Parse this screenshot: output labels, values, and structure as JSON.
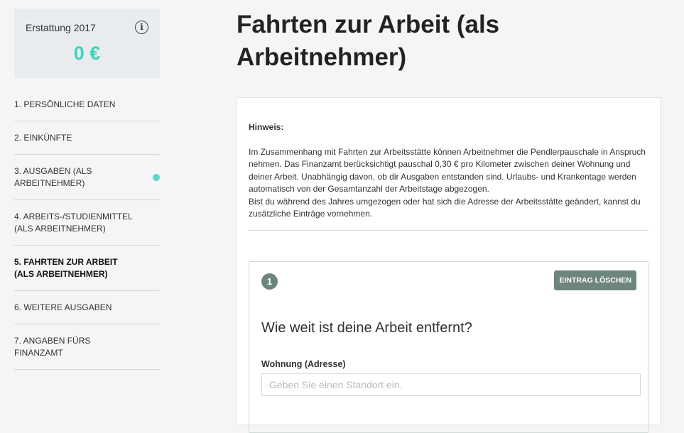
{
  "refund": {
    "title": "Erstattung 2017",
    "amount": "0 €"
  },
  "nav": {
    "items": [
      {
        "label": "1. PERSÖNLICHE DATEN"
      },
      {
        "label": "2. EINKÜNFTE"
      },
      {
        "label": "3. AUSGABEN (ALS ARBEITNEHMER)"
      },
      {
        "label": "4. ARBEITS-/STUDIENMITTEL (ALS ARBEITNEHMER)"
      },
      {
        "label": "5. FAHRTEN ZUR ARBEIT (ALS ARBEITNEHMER)"
      },
      {
        "label": "6. WEITERE AUSGABEN"
      },
      {
        "label": "7. ANGABEN FÜRS FINANZAMT"
      }
    ],
    "active_index": 4,
    "dot_color": "#5ed6cb"
  },
  "page": {
    "title": "Fahrten zur Arbeit (als Arbeitnehmer)"
  },
  "hint": {
    "label": "Hinweis:",
    "text1": "Im Zusammenhang mit Fahrten zur Arbeitsstätte können Arbeitnehmer die Pendlerpauschale in Anspruch nehmen. Das Finanzamt berücksichtigt pauschal 0,30 € pro Kilometer zwischen deiner Wohnung und deiner Arbeit. Unabhängig davon, ob dir Ausgaben entstanden sind. Urlaubs- und Krankentage werden automatisch von der Gesamtanzahl der Arbeitstage abgezogen.",
    "text2": "Bist du während des Jahres umgezogen oder hat sich die Adresse der Arbeitsstätte geändert, kannst du zusätzliche Einträge vornehmen."
  },
  "entry": {
    "number": "1",
    "delete_label": "EINTRAG LÖSCHEN",
    "question": "Wie weit ist deine Arbeit entfernt?",
    "address_label": "Wohnung (Adresse)",
    "address_value": "",
    "address_placeholder": "Geben Sie einen Standort ein."
  },
  "colors": {
    "accent": "#3dd3ba",
    "button": "#6e857d"
  }
}
